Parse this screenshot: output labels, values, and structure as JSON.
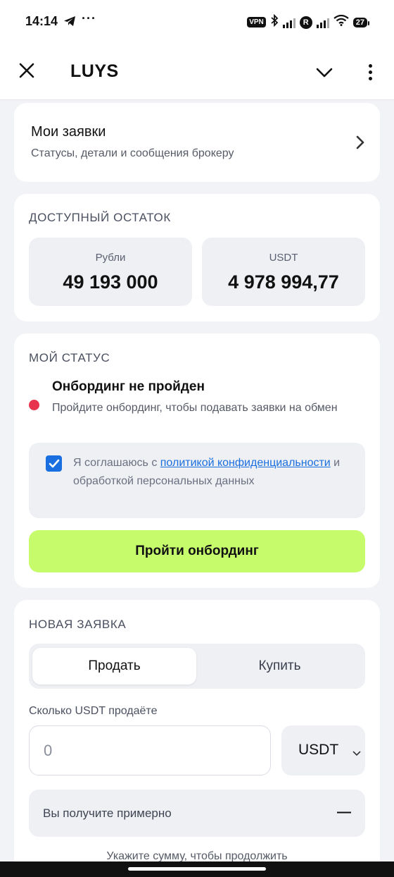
{
  "statusbar": {
    "time": "14:14",
    "more": "···",
    "vpn": "VPN",
    "r_badge": "R",
    "battery": "27"
  },
  "appbar": {
    "title": "LUYS"
  },
  "requests": {
    "title": "Мои заявки",
    "subtitle": "Статусы, детали и сообщения брокеру"
  },
  "balance": {
    "section_label": "ДОСТУПНЫЙ ОСТАТОК",
    "rub_label": "Рубли",
    "rub_value": "49 193 000",
    "usdt_label": "USDT",
    "usdt_value": "4 978 994,77"
  },
  "status": {
    "section_label": "МОЙ СТАТУС",
    "title": "Онбординг не пройден",
    "description": "Пройдите онбординг, чтобы подавать заявки на обмен",
    "status_color": "#e8334f",
    "consent": {
      "checked": true,
      "prefix": "Я соглашаюсь с ",
      "link_text": "политикой конфиденциальности",
      "suffix": " и обработкой персональных данных"
    },
    "button_label": "Пройти онбординг",
    "button_color": "#c6fb6c"
  },
  "new_request": {
    "section_label": "НОВАЯ ЗАЯВКА",
    "tabs": [
      {
        "label": "Продать",
        "active": true
      },
      {
        "label": "Купить",
        "active": false
      }
    ],
    "amount_label": "Сколько USDT продаёте",
    "amount_placeholder": "0",
    "currency": "USDT",
    "receive_label": "Вы получите примерно",
    "receive_value": "—",
    "hint": "Укажите сумму, чтобы продолжить"
  }
}
